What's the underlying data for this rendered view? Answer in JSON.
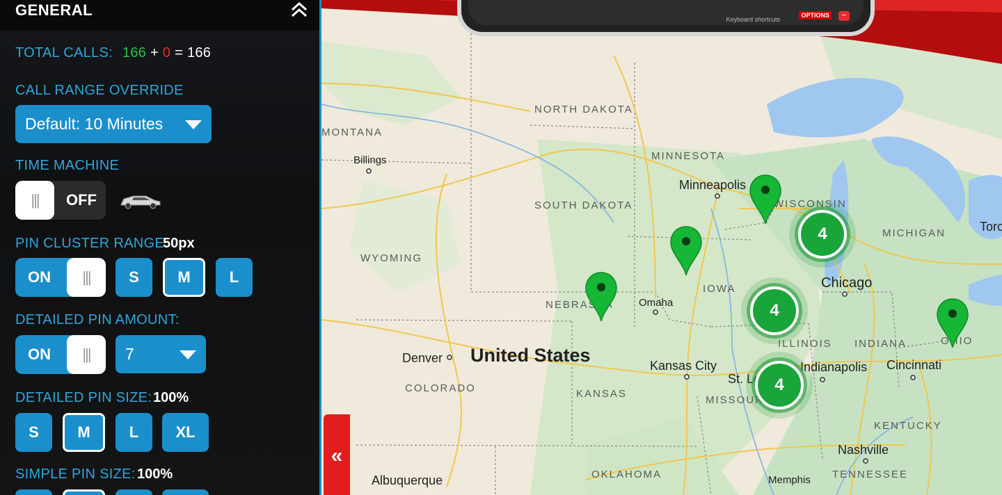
{
  "panel": {
    "title": "GENERAL",
    "total_calls": {
      "label": "TOTAL CALLS:",
      "a": "166",
      "plus": "+",
      "b": "0",
      "eq": "=",
      "total": "166"
    },
    "call_range": {
      "label": "CALL RANGE OVERRIDE",
      "value": "Default: 10 Minutes"
    },
    "time_machine": {
      "label": "TIME MACHINE",
      "state": "OFF",
      "icon": "delorean-car-icon"
    },
    "pin_cluster": {
      "label": "PIN CLUSTER RANGE",
      "value": "50px",
      "toggle": "ON",
      "sizes": [
        "S",
        "M",
        "L"
      ],
      "selected": "M"
    },
    "detailed_amount": {
      "label": "DETAILED PIN AMOUNT:",
      "toggle": "ON",
      "value": "7"
    },
    "detailed_size": {
      "label": "DETAILED PIN SIZE:",
      "value": "100%",
      "sizes": [
        "S",
        "M",
        "L",
        "XL"
      ],
      "selected": "M"
    },
    "simple_size": {
      "label": "SIMPLE PIN SIZE:",
      "value": "100%"
    }
  },
  "collapse_tab": "«",
  "phone": {
    "keyboard": "Keyboard shortcuts",
    "options": "OPTIONS"
  },
  "map": {
    "country": "United States",
    "states": [
      "MONTANA",
      "NORTH DAKOTA",
      "SOUTH DAKOTA",
      "MINNESOTA",
      "WISCONSIN",
      "MICHIGAN",
      "WYOMING",
      "NEBRASKA",
      "IOWA",
      "ILLINOIS",
      "INDIANA",
      "OHIO",
      "COLORADO",
      "KANSAS",
      "MISSOURI",
      "KENTUCKY",
      "TENNESSEE",
      "OKLAHOMA"
    ],
    "cities": [
      "Billings",
      "Minneapolis",
      "Chicago",
      "Omaha",
      "Denver",
      "Kansas City",
      "St. Louis",
      "Indianapolis",
      "Cincinnati",
      "Nashville",
      "Memphis",
      "Albuquerque",
      "Toronto"
    ],
    "clusters": [
      "4",
      "4",
      "4"
    ],
    "colors": {
      "pin": "#16b636",
      "cluster": "#1aa53a",
      "accent": "#1a8fcc",
      "brand_red": "#e11d1d"
    }
  }
}
